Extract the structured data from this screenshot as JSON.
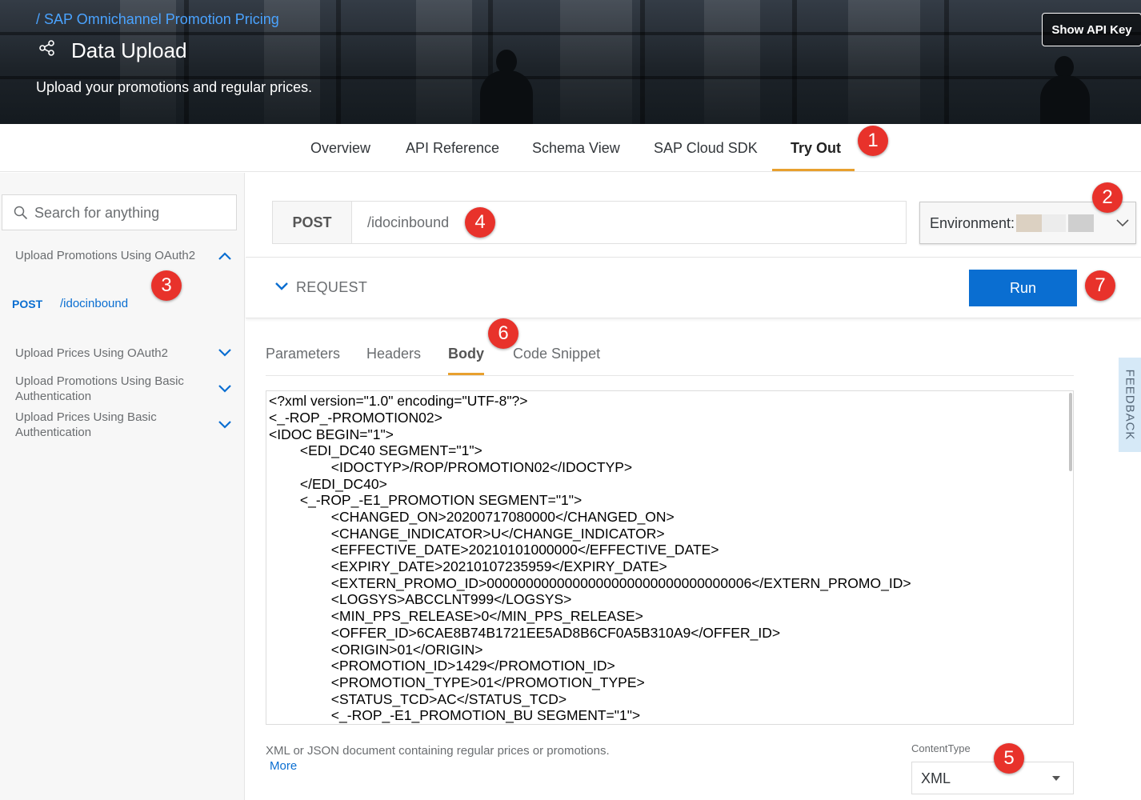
{
  "header": {
    "breadcrumb": "/ SAP Omnichannel Promotion Pricing",
    "title": "Data Upload",
    "subtitle": "Upload your promotions and regular prices.",
    "show_api_key_label": "Show API Key"
  },
  "tabs": [
    {
      "label": "Overview"
    },
    {
      "label": "API Reference"
    },
    {
      "label": "Schema View"
    },
    {
      "label": "SAP Cloud SDK"
    },
    {
      "label": "Try Out",
      "active": true
    }
  ],
  "callouts": [
    "1",
    "2",
    "3",
    "4",
    "5",
    "6",
    "7"
  ],
  "sidebar": {
    "search_placeholder": "Search for anything",
    "groups": [
      {
        "label": "Upload Promotions Using OAuth2",
        "expanded": true
      },
      {
        "label": "Upload Prices Using OAuth2",
        "expanded": false
      },
      {
        "label": "Upload Promotions Using Basic Authentication",
        "expanded": false
      },
      {
        "label": "Upload Prices Using Basic Authentication",
        "expanded": false
      }
    ],
    "endpoint": {
      "method": "POST",
      "path": "/idocinbound"
    }
  },
  "endpoint_bar": {
    "method": "POST",
    "path": "/idocinbound",
    "environment_label": "Environment:"
  },
  "request": {
    "label": "REQUEST",
    "run_label": "Run"
  },
  "sub_tabs": [
    {
      "label": "Parameters"
    },
    {
      "label": "Headers"
    },
    {
      "label": "Body",
      "active": true
    },
    {
      "label": "Code Snippet"
    }
  ],
  "body_lines": [
    "<?xml version=\"1.0\" encoding=\"UTF-8\"?>",
    "<_-ROP_-PROMOTION02>",
    "<IDOC BEGIN=\"1\">",
    "        <EDI_DC40 SEGMENT=\"1\">",
    "                <IDOCTYP>/ROP/PROMOTION02</IDOCTYP>",
    "        </EDI_DC40>",
    "        <_-ROP_-E1_PROMOTION SEGMENT=\"1\">",
    "                <CHANGED_ON>20200717080000</CHANGED_ON>",
    "                <CHANGE_INDICATOR>U</CHANGE_INDICATOR>",
    "                <EFFECTIVE_DATE>20210101000000</EFFECTIVE_DATE>",
    "                <EXPIRY_DATE>20210107235959</EXPIRY_DATE>",
    "                <EXTERN_PROMO_ID>0000000000000000000000000000000006</EXTERN_PROMO_ID>",
    "                <LOGSYS>ABCCLNT999</LOGSYS>",
    "                <MIN_PPS_RELEASE>0</MIN_PPS_RELEASE>",
    "                <OFFER_ID>6CAE8B74B1721EE5AD8B6CF0A5B310A9</OFFER_ID>",
    "                <ORIGIN>01</ORIGIN>",
    "                <PROMOTION_ID>1429</PROMOTION_ID>",
    "                <PROMOTION_TYPE>01</PROMOTION_TYPE>",
    "                <STATUS_TCD>AC</STATUS_TCD>",
    "                <_-ROP_-E1_PROMOTION_BU SEGMENT=\"1\">"
  ],
  "feedback_label": "FEEDBACK",
  "footer": {
    "description": "XML or JSON document containing regular prices or promotions.",
    "more_label": "More",
    "content_type_label": "ContentType",
    "content_type_value": "XML"
  },
  "colors": {
    "accent": "#0a6ed1",
    "tab_underline": "#e8a02e",
    "callout": "#e8322b"
  }
}
